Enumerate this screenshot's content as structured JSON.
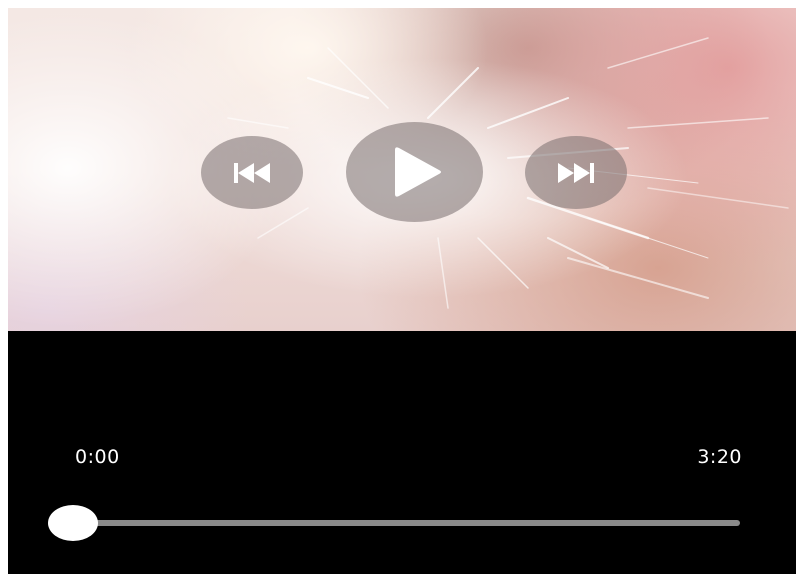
{
  "player": {
    "controls": {
      "previous_icon": "skip-previous-icon",
      "play_icon": "play-icon",
      "next_icon": "skip-next-icon"
    },
    "time_elapsed": "0:00",
    "time_total": "3:20",
    "progress": 0.0
  },
  "colors": {
    "panel_background": "#000000",
    "track": "#8a8a8a",
    "thumb": "#ffffff",
    "control_fill": "#786e6e"
  }
}
